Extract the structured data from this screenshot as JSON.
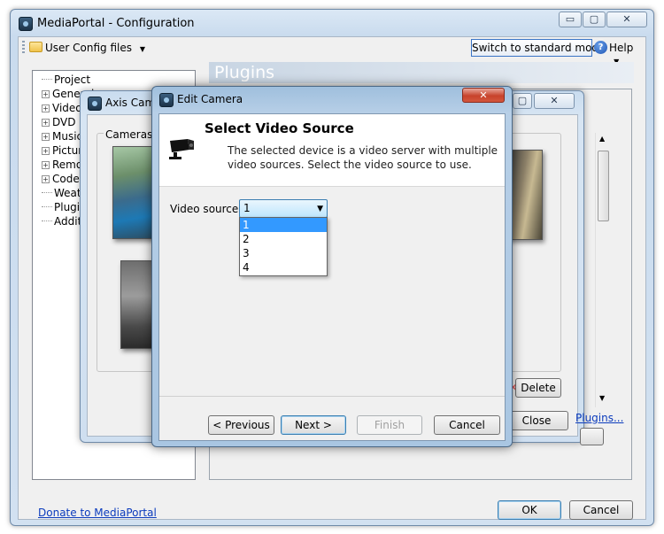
{
  "main_window": {
    "title": "MediaPortal - Configuration",
    "caption": {
      "minimize": "▭",
      "maximize": "▢",
      "close": "✕"
    },
    "toolbar": {
      "config_label": "User Config files",
      "switch_mode_label": "Switch to standard mode",
      "help_label": "Help",
      "help_icon": "?"
    },
    "tree": [
      {
        "label": "Project",
        "expandable": false
      },
      {
        "label": "General",
        "expandable": true
      },
      {
        "label": "Videos",
        "expandable": true
      },
      {
        "label": "DVD",
        "expandable": true
      },
      {
        "label": "Music",
        "expandable": true
      },
      {
        "label": "Pictures",
        "expandable": true
      },
      {
        "label": "Remote",
        "expandable": true
      },
      {
        "label": "Codecs",
        "expandable": true
      },
      {
        "label": "Weather",
        "expandable": false
      },
      {
        "label": "Plugins",
        "expandable": false
      },
      {
        "label": "Additional",
        "expandable": false
      }
    ],
    "panel_title": "Plugins",
    "plugins_link": "Plugins...",
    "donate_link": "Donate to MediaPortal",
    "ok_label": "OK",
    "cancel_label": "Cancel"
  },
  "axis_window": {
    "title": "Axis Cameras",
    "cameras_group_label": "Cameras",
    "delete_label": "Delete",
    "close_label": "Close",
    "close_glyph": "✕"
  },
  "edit_camera": {
    "title": "Edit Camera",
    "heading": "Select Video Source",
    "description": "The selected device is a video server with multiple video sources. Select the video source to use.",
    "video_source_label": "Video source:",
    "selected_value": "1",
    "options": [
      "1",
      "2",
      "3",
      "4"
    ],
    "buttons": {
      "previous": "< Previous",
      "next": "Next >",
      "finish": "Finish",
      "cancel": "Cancel"
    }
  },
  "colors": {
    "link": "#0b3bbd",
    "selection": "#3399ff",
    "title_bar": "#c9dbee"
  }
}
